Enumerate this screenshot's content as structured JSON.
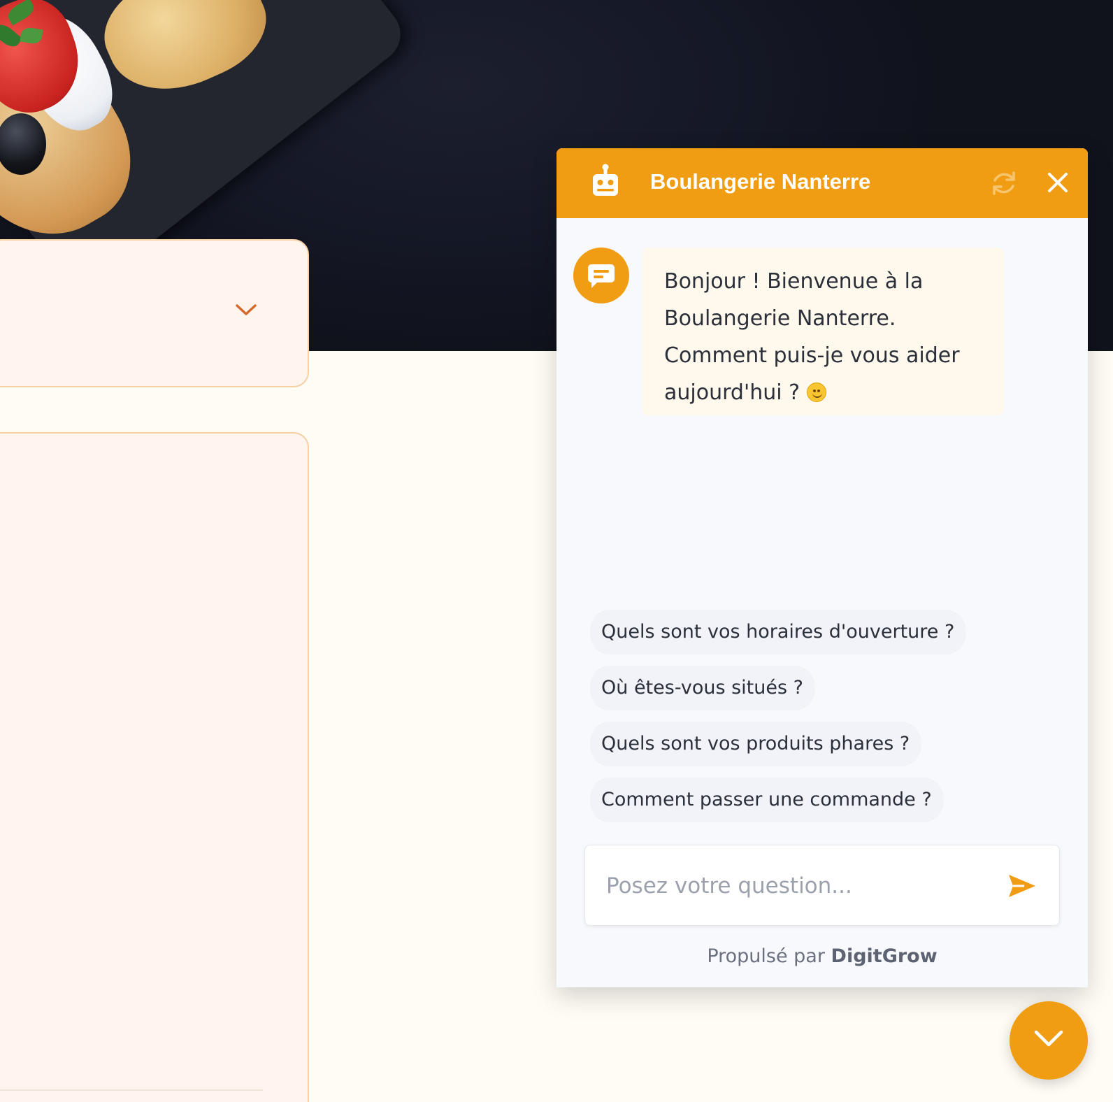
{
  "colors": {
    "accent": "#f09d14",
    "page_background": "#fffbf5",
    "panel_background": "#fff5ee",
    "panel_border": "#f6cfa3",
    "chat_background": "#f8f9fc",
    "bot_bubble": "#fff8ec",
    "chip_background": "#f1f3f9",
    "text_dark": "#2b2f3a"
  },
  "hero": {
    "image": "food-platter-photo"
  },
  "left_panel": {
    "icon": "chevron-down-icon"
  },
  "chat": {
    "title": "Boulangerie Nanterre",
    "header_icons": [
      "robot-icon",
      "refresh-icon",
      "close-icon"
    ],
    "avatar_icon": "chat-message-icon",
    "welcome_message": {
      "line1": "Bonjour ! Bienvenue à la",
      "line2": "Boulangerie Nanterre.",
      "line3": "Comment puis-je vous aider",
      "line4": "aujourd'hui ?",
      "emoji": "😊"
    },
    "suggestions": [
      "Quels sont vos horaires d'ouverture ?",
      "Où êtes-vous situés ?",
      "Quels sont vos produits phares ?",
      "Comment passer une commande ?"
    ],
    "input": {
      "placeholder": "Posez votre question...",
      "value": "",
      "send_icon": "send-icon"
    },
    "footer": {
      "prefix": "Propulsé par",
      "brand": "DigitGrow"
    }
  },
  "toggle_button": {
    "icon": "chevron-down-icon"
  }
}
